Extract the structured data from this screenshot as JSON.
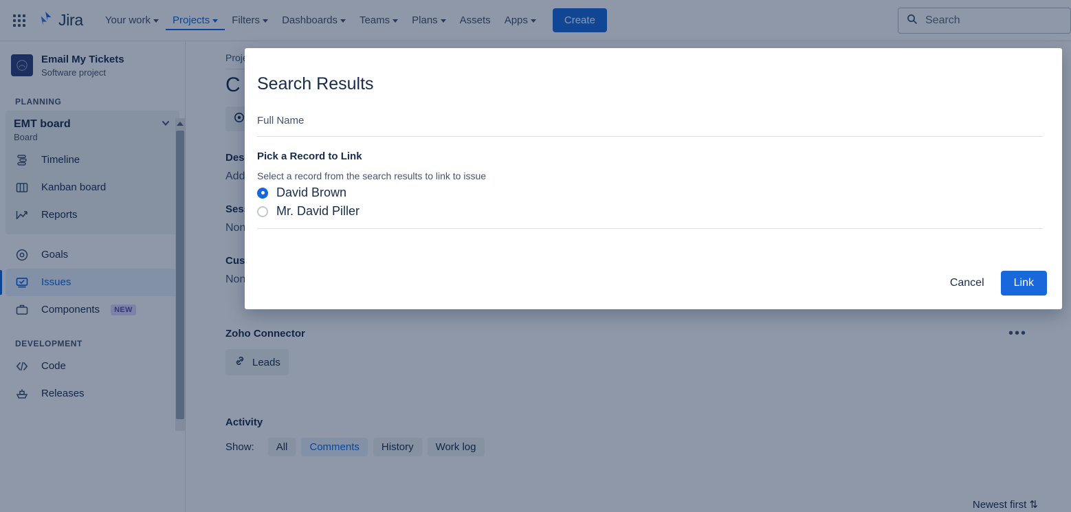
{
  "topnav": {
    "app_switcher_icon": "grid-apps-icon",
    "brand": "Jira",
    "brand_icon": "jira-logo-icon",
    "items": [
      {
        "label": "Your work",
        "has_caret": true,
        "active": false
      },
      {
        "label": "Projects",
        "has_caret": true,
        "active": true
      },
      {
        "label": "Filters",
        "has_caret": true,
        "active": false
      },
      {
        "label": "Dashboards",
        "has_caret": true,
        "active": false
      },
      {
        "label": "Teams",
        "has_caret": true,
        "active": false
      },
      {
        "label": "Plans",
        "has_caret": true,
        "active": false
      },
      {
        "label": "Assets",
        "has_caret": false,
        "active": false
      },
      {
        "label": "Apps",
        "has_caret": true,
        "active": false
      }
    ],
    "create_label": "Create",
    "search": {
      "placeholder": "Search",
      "icon": "search-icon",
      "value": ""
    },
    "accent_color": "#1868db"
  },
  "sidebar": {
    "project_name": "Email My Tickets",
    "project_type": "Software project",
    "project_avatar_icon": "project-avatar-icon",
    "sections": [
      {
        "label": "PLANNING"
      },
      {
        "label": "DEVELOPMENT"
      }
    ],
    "board": {
      "name": "EMT board",
      "kind": "Board",
      "chevron_icon": "chevron-down-icon",
      "items": [
        {
          "label": "Timeline",
          "icon": "timeline-icon"
        },
        {
          "label": "Kanban board",
          "icon": "board-columns-icon"
        },
        {
          "label": "Reports",
          "icon": "reports-chart-icon"
        }
      ]
    },
    "items": [
      {
        "label": "Goals",
        "icon": "goal-target-icon",
        "selected": false,
        "badge": ""
      },
      {
        "label": "Issues",
        "icon": "issues-icon",
        "selected": true,
        "badge": ""
      },
      {
        "label": "Components",
        "icon": "components-icon",
        "selected": false,
        "badge": "NEW"
      }
    ],
    "development_items": [
      {
        "label": "Code",
        "icon": "code-brackets-icon"
      },
      {
        "label": "Releases",
        "icon": "releases-ship-icon"
      }
    ],
    "scrollbar": {
      "up_arrow_icon": "scroll-up-arrow-icon"
    }
  },
  "content": {
    "breadcrumb": "Projects",
    "issue_title": "C",
    "chip": {
      "label": "",
      "icon": "issue-type-icon"
    },
    "fields": [
      {
        "label": "Description",
        "value": "Add a description..."
      },
      {
        "label": "Sessions",
        "value": "None"
      },
      {
        "label": "Customers",
        "value": "None"
      }
    ],
    "zoho_section": {
      "title": "Zoho Connector",
      "more_icon": "more-actions-icon",
      "more_label": "•••",
      "chip": {
        "label": "Leads",
        "icon": "link-chain-icon"
      }
    },
    "activity": {
      "title": "Activity",
      "show_label": "Show:",
      "tabs": [
        {
          "label": "All",
          "selected": false
        },
        {
          "label": "Comments",
          "selected": true
        },
        {
          "label": "History",
          "selected": false
        },
        {
          "label": "Work log",
          "selected": false
        }
      ],
      "sort_label": "Newest first ⇅"
    }
  },
  "modal": {
    "title": "Search Results",
    "full_name_label": "Full Name",
    "full_name_value": "",
    "pick_record_label": "Pick a Record to Link",
    "pick_record_help": "Select a record from the search results to link to issue",
    "records": [
      {
        "label": "David Brown",
        "selected": true
      },
      {
        "label": "Mr. David Piller",
        "selected": false
      }
    ],
    "cancel_label": "Cancel",
    "link_label": "Link",
    "primary_color": "#1868db"
  }
}
